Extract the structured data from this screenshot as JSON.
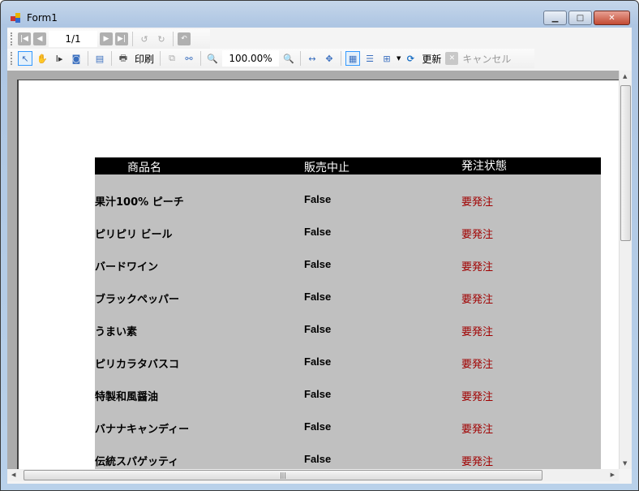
{
  "window": {
    "title": "Form1"
  },
  "toolbar1": {
    "page_indicator": "1/1"
  },
  "toolbar2": {
    "print_label": "印刷",
    "zoom_value": "100.00%",
    "refresh_label": "更新",
    "cancel_label": "キャンセル"
  },
  "report": {
    "headers": [
      "商品名",
      "販売中止",
      "発注状態"
    ],
    "rows": [
      {
        "name": "果汁100% ピーチ",
        "discontinued": "False",
        "status": "要発注"
      },
      {
        "name": "ピリピリ ビール",
        "discontinued": "False",
        "status": "要発注"
      },
      {
        "name": "バードワイン",
        "discontinued": "False",
        "status": "要発注"
      },
      {
        "name": "ブラックペッパー",
        "discontinued": "False",
        "status": "要発注"
      },
      {
        "name": "うまい素",
        "discontinued": "False",
        "status": "要発注"
      },
      {
        "name": "ピリカラタバスコ",
        "discontinued": "False",
        "status": "要発注"
      },
      {
        "name": "特製和風醤油",
        "discontinued": "False",
        "status": "要発注"
      },
      {
        "name": "バナナキャンディー",
        "discontinued": "False",
        "status": "要発注"
      },
      {
        "name": "伝統スパゲッティ",
        "discontinued": "False",
        "status": "要発注"
      }
    ]
  },
  "colors": {
    "status": "#a00000",
    "header_bg": "#000000",
    "row_bg": "#c0c0c0"
  }
}
